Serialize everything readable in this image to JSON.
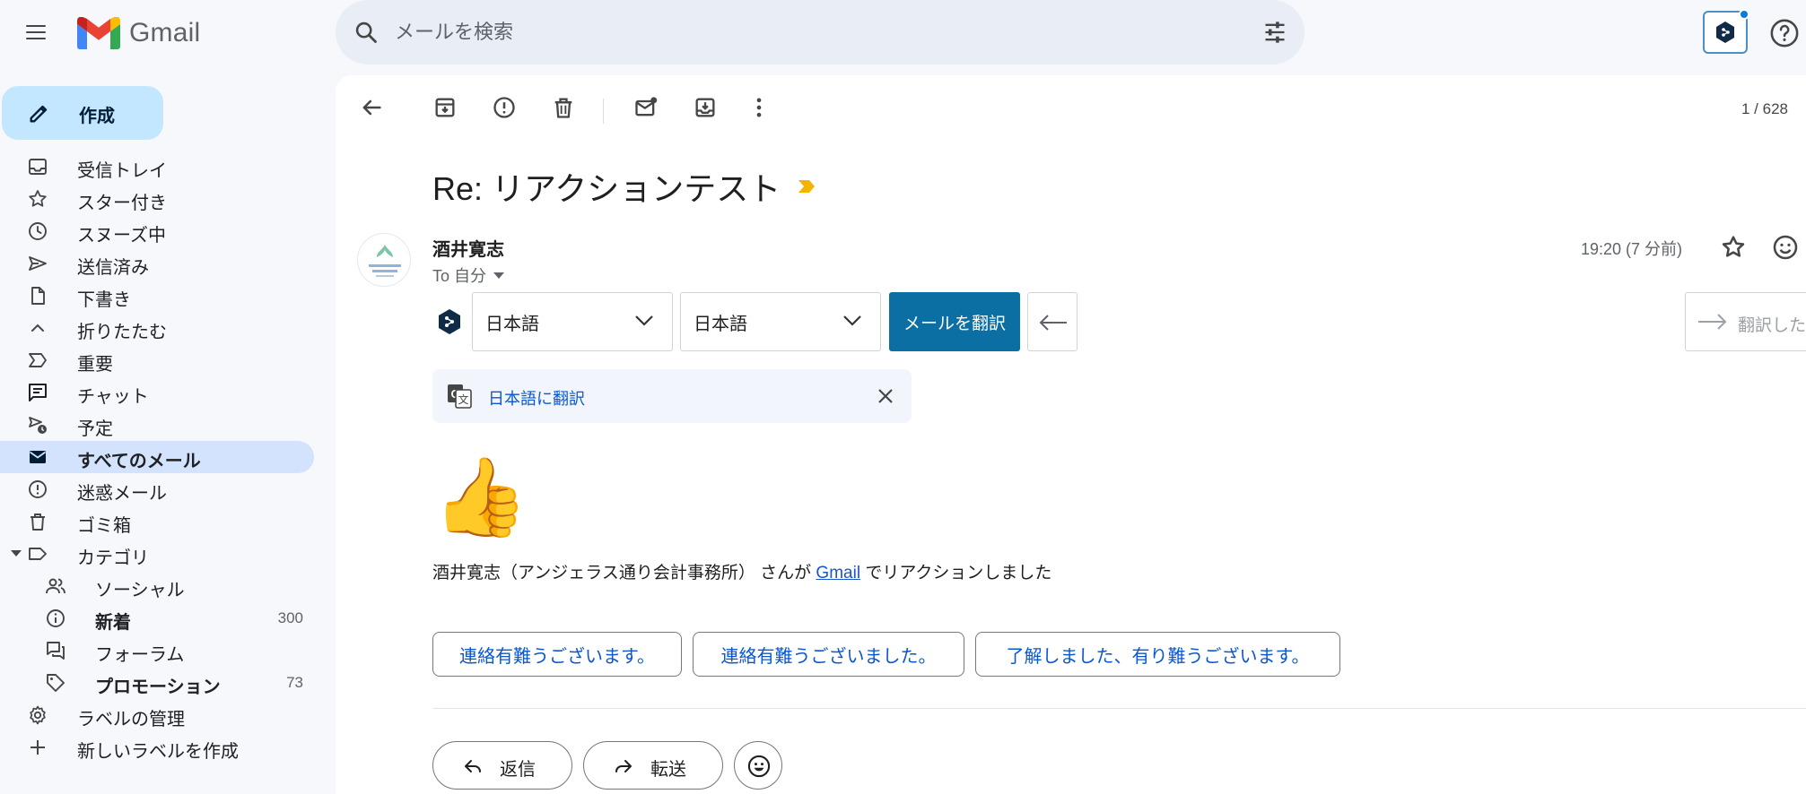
{
  "app": {
    "name": "Gmail"
  },
  "search": {
    "placeholder": "メールを検索"
  },
  "sidebar": {
    "compose_label": "作成",
    "items": [
      {
        "label": "受信トレイ"
      },
      {
        "label": "スター付き"
      },
      {
        "label": "スヌーズ中"
      },
      {
        "label": "送信済み"
      },
      {
        "label": "下書き"
      },
      {
        "label": "折りたたむ"
      },
      {
        "label": "重要"
      },
      {
        "label": "チャット"
      },
      {
        "label": "予定"
      },
      {
        "label": "すべてのメール",
        "active": true
      },
      {
        "label": "迷惑メール"
      },
      {
        "label": "ゴミ箱"
      },
      {
        "label": "カテゴリ"
      },
      {
        "label": "ソーシャル"
      },
      {
        "label": "新着",
        "count": "300"
      },
      {
        "label": "フォーラム"
      },
      {
        "label": "プロモーション",
        "count": "73"
      },
      {
        "label": "ラベルの管理"
      },
      {
        "label": "新しいラベルを作成"
      }
    ]
  },
  "toolbar": {
    "pager": "1 / 628"
  },
  "message": {
    "subject": "Re: リアクションテスト",
    "sender_name": "酒井寛志",
    "to_label": "To 自分",
    "time": "19:20 (7 分前)",
    "reaction_emoji": "👍",
    "reaction_text_before": "酒井寛志（アンジェラス通り会計事務所） さんが ",
    "reaction_link": "Gmail",
    "reaction_text_after": " でリアクションしました"
  },
  "translator": {
    "source_lang": "日本語",
    "target_lang": "日本語",
    "translate_button": "メールを翻訳",
    "translated_button": "翻訳した×"
  },
  "google_translate": {
    "label": "日本語に翻訳"
  },
  "smart_replies": [
    "連絡有難うございます。",
    "連絡有難うございました。",
    "了解しました、有り難うございます。"
  ],
  "actions": {
    "reply": "返信",
    "forward": "転送"
  },
  "colors": {
    "accent": "#0b57d0",
    "compose_bg": "#c2e7ff",
    "active_nav_bg": "#d3e3fd",
    "translate_button_bg": "#0b6fa4"
  }
}
